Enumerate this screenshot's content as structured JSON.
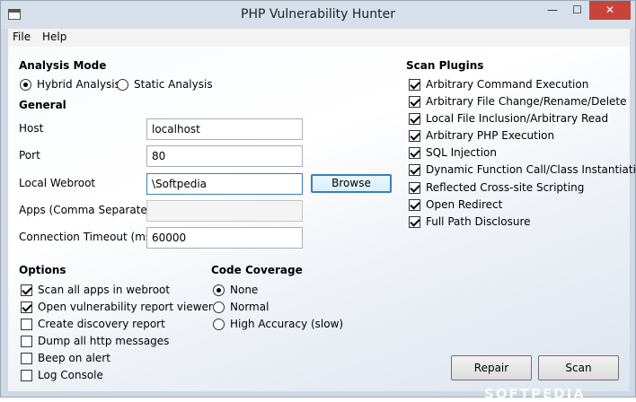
{
  "window": {
    "title": "PHP Vulnerability Hunter",
    "minimize": "—",
    "maximize": "☐",
    "close": "✕"
  },
  "menu": {
    "file": "File",
    "help": "Help"
  },
  "analysis_mode": {
    "heading": "Analysis Mode",
    "options": [
      {
        "label": "Hybrid Analysis",
        "selected": true
      },
      {
        "label": "Static Analysis",
        "selected": false
      }
    ]
  },
  "general": {
    "heading": "General",
    "host": {
      "label": "Host",
      "value": "localhost"
    },
    "port": {
      "label": "Port",
      "value": "80"
    },
    "webroot": {
      "label": "Local Webroot",
      "value": "\\Softpedia",
      "browse": "Browse"
    },
    "apps": {
      "label": "Apps (Comma Separated)",
      "value": ""
    },
    "timeout": {
      "label": "Connection Timeout (ms)",
      "value": "60000"
    }
  },
  "options": {
    "heading": "Options",
    "items": [
      {
        "label": "Scan all apps in webroot",
        "checked": true
      },
      {
        "label": "Open vulnerability report viewer",
        "checked": true
      },
      {
        "label": "Create discovery report",
        "checked": false
      },
      {
        "label": "Dump all http messages",
        "checked": false
      },
      {
        "label": "Beep on alert",
        "checked": false
      },
      {
        "label": "Log Console",
        "checked": false
      }
    ]
  },
  "code_coverage": {
    "heading": "Code Coverage",
    "items": [
      {
        "label": "None",
        "selected": true
      },
      {
        "label": "Normal",
        "selected": false
      },
      {
        "label": "High Accuracy (slow)",
        "selected": false
      }
    ]
  },
  "scan_plugins": {
    "heading": "Scan Plugins",
    "items": [
      {
        "label": "Arbitrary Command Execution",
        "checked": true
      },
      {
        "label": "Arbitrary File Change/Rename/Delete",
        "checked": true
      },
      {
        "label": "Local File Inclusion/Arbitrary Read",
        "checked": true
      },
      {
        "label": "Arbitrary PHP Execution",
        "checked": true
      },
      {
        "label": "SQL Injection",
        "checked": true
      },
      {
        "label": "Dynamic Function Call/Class Instantiation",
        "checked": true
      },
      {
        "label": "Reflected Cross-site Scripting",
        "checked": true
      },
      {
        "label": "Open Redirect",
        "checked": true
      },
      {
        "label": "Full Path Disclosure",
        "checked": true
      }
    ]
  },
  "actions": {
    "repair": "Repair",
    "scan": "Scan"
  },
  "watermark": "SOFTPEDIA"
}
